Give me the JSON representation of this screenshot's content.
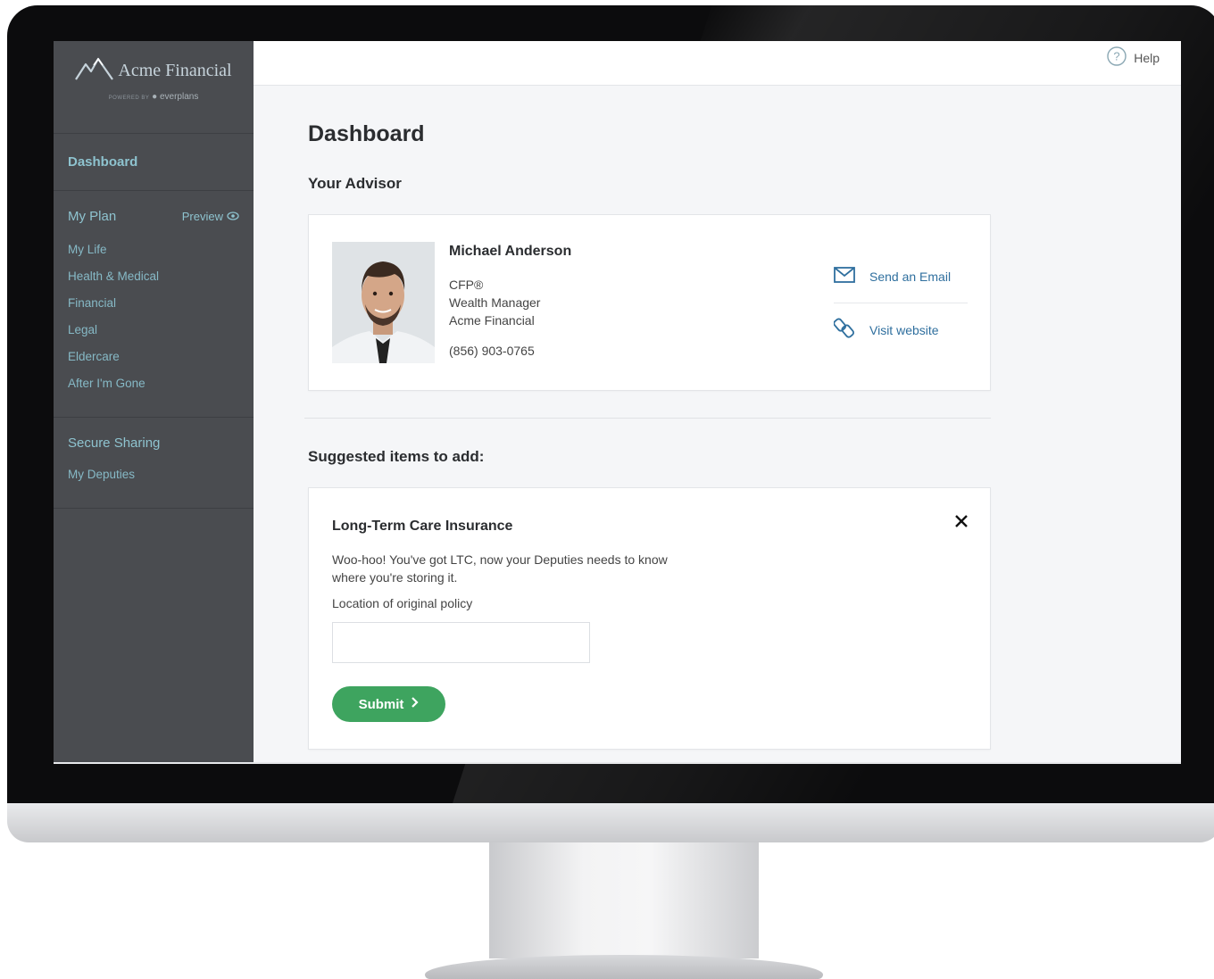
{
  "brand": {
    "name": "Acme Financial",
    "powered_by": "POWERED BY",
    "partner": "everplans"
  },
  "sidebar": {
    "dashboard": "Dashboard",
    "my_plan": "My Plan",
    "preview": "Preview",
    "plan_items": [
      "My Life",
      "Health & Medical",
      "Financial",
      "Legal",
      "Eldercare",
      "After I'm Gone"
    ],
    "secure_sharing": "Secure Sharing",
    "my_deputies": "My Deputies"
  },
  "topbar": {
    "help": "Help"
  },
  "main": {
    "title": "Dashboard",
    "your_advisor": "Your Advisor",
    "advisor": {
      "name": "Michael Anderson",
      "credential": "CFP®",
      "role": "Wealth Manager",
      "company": "Acme Financial",
      "phone": "(856) 903-0765",
      "send_email": "Send an Email",
      "visit_website": "Visit website"
    },
    "suggested_title": "Suggested items to add:",
    "suggestion": {
      "title": "Long-Term Care Insurance",
      "body": "Woo-hoo! You've got LTC, now your Deputies needs to know where you're storing it.",
      "field_label": "Location of original policy",
      "field_value": "",
      "submit": "Submit"
    }
  },
  "colors": {
    "sidebar_bg": "#4a4c50",
    "sidebar_text": "#8ec3cf",
    "link_blue": "#2f6f9e",
    "submit_green": "#3ea45f"
  }
}
